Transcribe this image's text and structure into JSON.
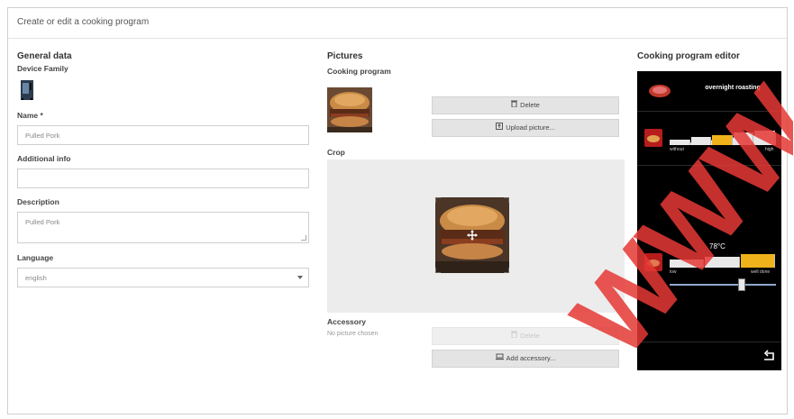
{
  "window": {
    "title": "Create or edit a cooking program"
  },
  "general": {
    "title": "General data",
    "device_family_label": "Device Family",
    "name_label": "Name *",
    "name_value": "Pulled Pork",
    "additional_info_label": "Additional info",
    "additional_info_value": "",
    "description_label": "Description",
    "description_value": "Pulled Pork",
    "language_label": "Language",
    "language_value": "english"
  },
  "pictures": {
    "title": "Pictures",
    "cooking_program_label": "Cooking program",
    "delete_label": "Delete",
    "upload_label": "Upload picture...",
    "crop_label": "Crop",
    "accessory_label": "Accessory",
    "no_picture_text": "No picture chosen",
    "accessory_delete_label": "Delete",
    "add_accessory_label": "Add accessory..."
  },
  "editor": {
    "title": "Cooking program editor",
    "mode_label": "overnight roasting",
    "browning_low": "without",
    "browning_high": "high",
    "temperature_readout": "78°C",
    "doneness_low": "low",
    "doneness_high": "well done",
    "browning_level": 2,
    "browning_steps": 5,
    "doneness_level": 3,
    "doneness_steps": 3,
    "slider_value": 0.69,
    "accent_color": "#f0b21a",
    "back_icon": "return-arrow-icon"
  },
  "watermark": {
    "text": "WWW"
  }
}
